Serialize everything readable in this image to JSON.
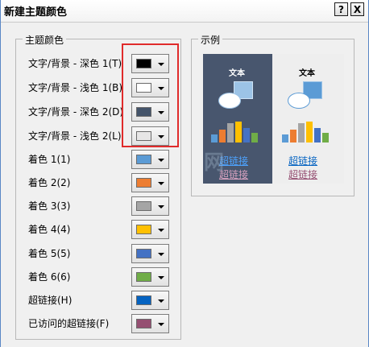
{
  "window": {
    "title": "新建主题颜色",
    "help_label": "?",
    "close_label": "X"
  },
  "theme_colors": {
    "legend": "主题颜色",
    "rows": [
      {
        "label": "文字/背景 - 深色 1(T)",
        "color": "#000000"
      },
      {
        "label": "文字/背景 - 浅色 1(B)",
        "color": "#ffffff"
      },
      {
        "label": "文字/背景 - 深色 2(D)",
        "color": "#44546a"
      },
      {
        "label": "文字/背景 - 浅色 2(L)",
        "color": "#e7e6e6"
      },
      {
        "label": "着色 1(1)",
        "color": "#5b9bd5"
      },
      {
        "label": "着色 2(2)",
        "color": "#ed7d31"
      },
      {
        "label": "着色 3(3)",
        "color": "#a5a5a5"
      },
      {
        "label": "着色 4(4)",
        "color": "#ffc000"
      },
      {
        "label": "着色 5(5)",
        "color": "#4472c4"
      },
      {
        "label": "着色 6(6)",
        "color": "#70ad47"
      },
      {
        "label": "超链接(H)",
        "color": "#0563c1"
      },
      {
        "label": "已访问的超链接(F)",
        "color": "#954f72"
      }
    ]
  },
  "sample": {
    "legend": "示例",
    "text_label": "文本",
    "hyperlink": "超链接",
    "visited_hyperlink": "超链接"
  },
  "watermark": "网"
}
